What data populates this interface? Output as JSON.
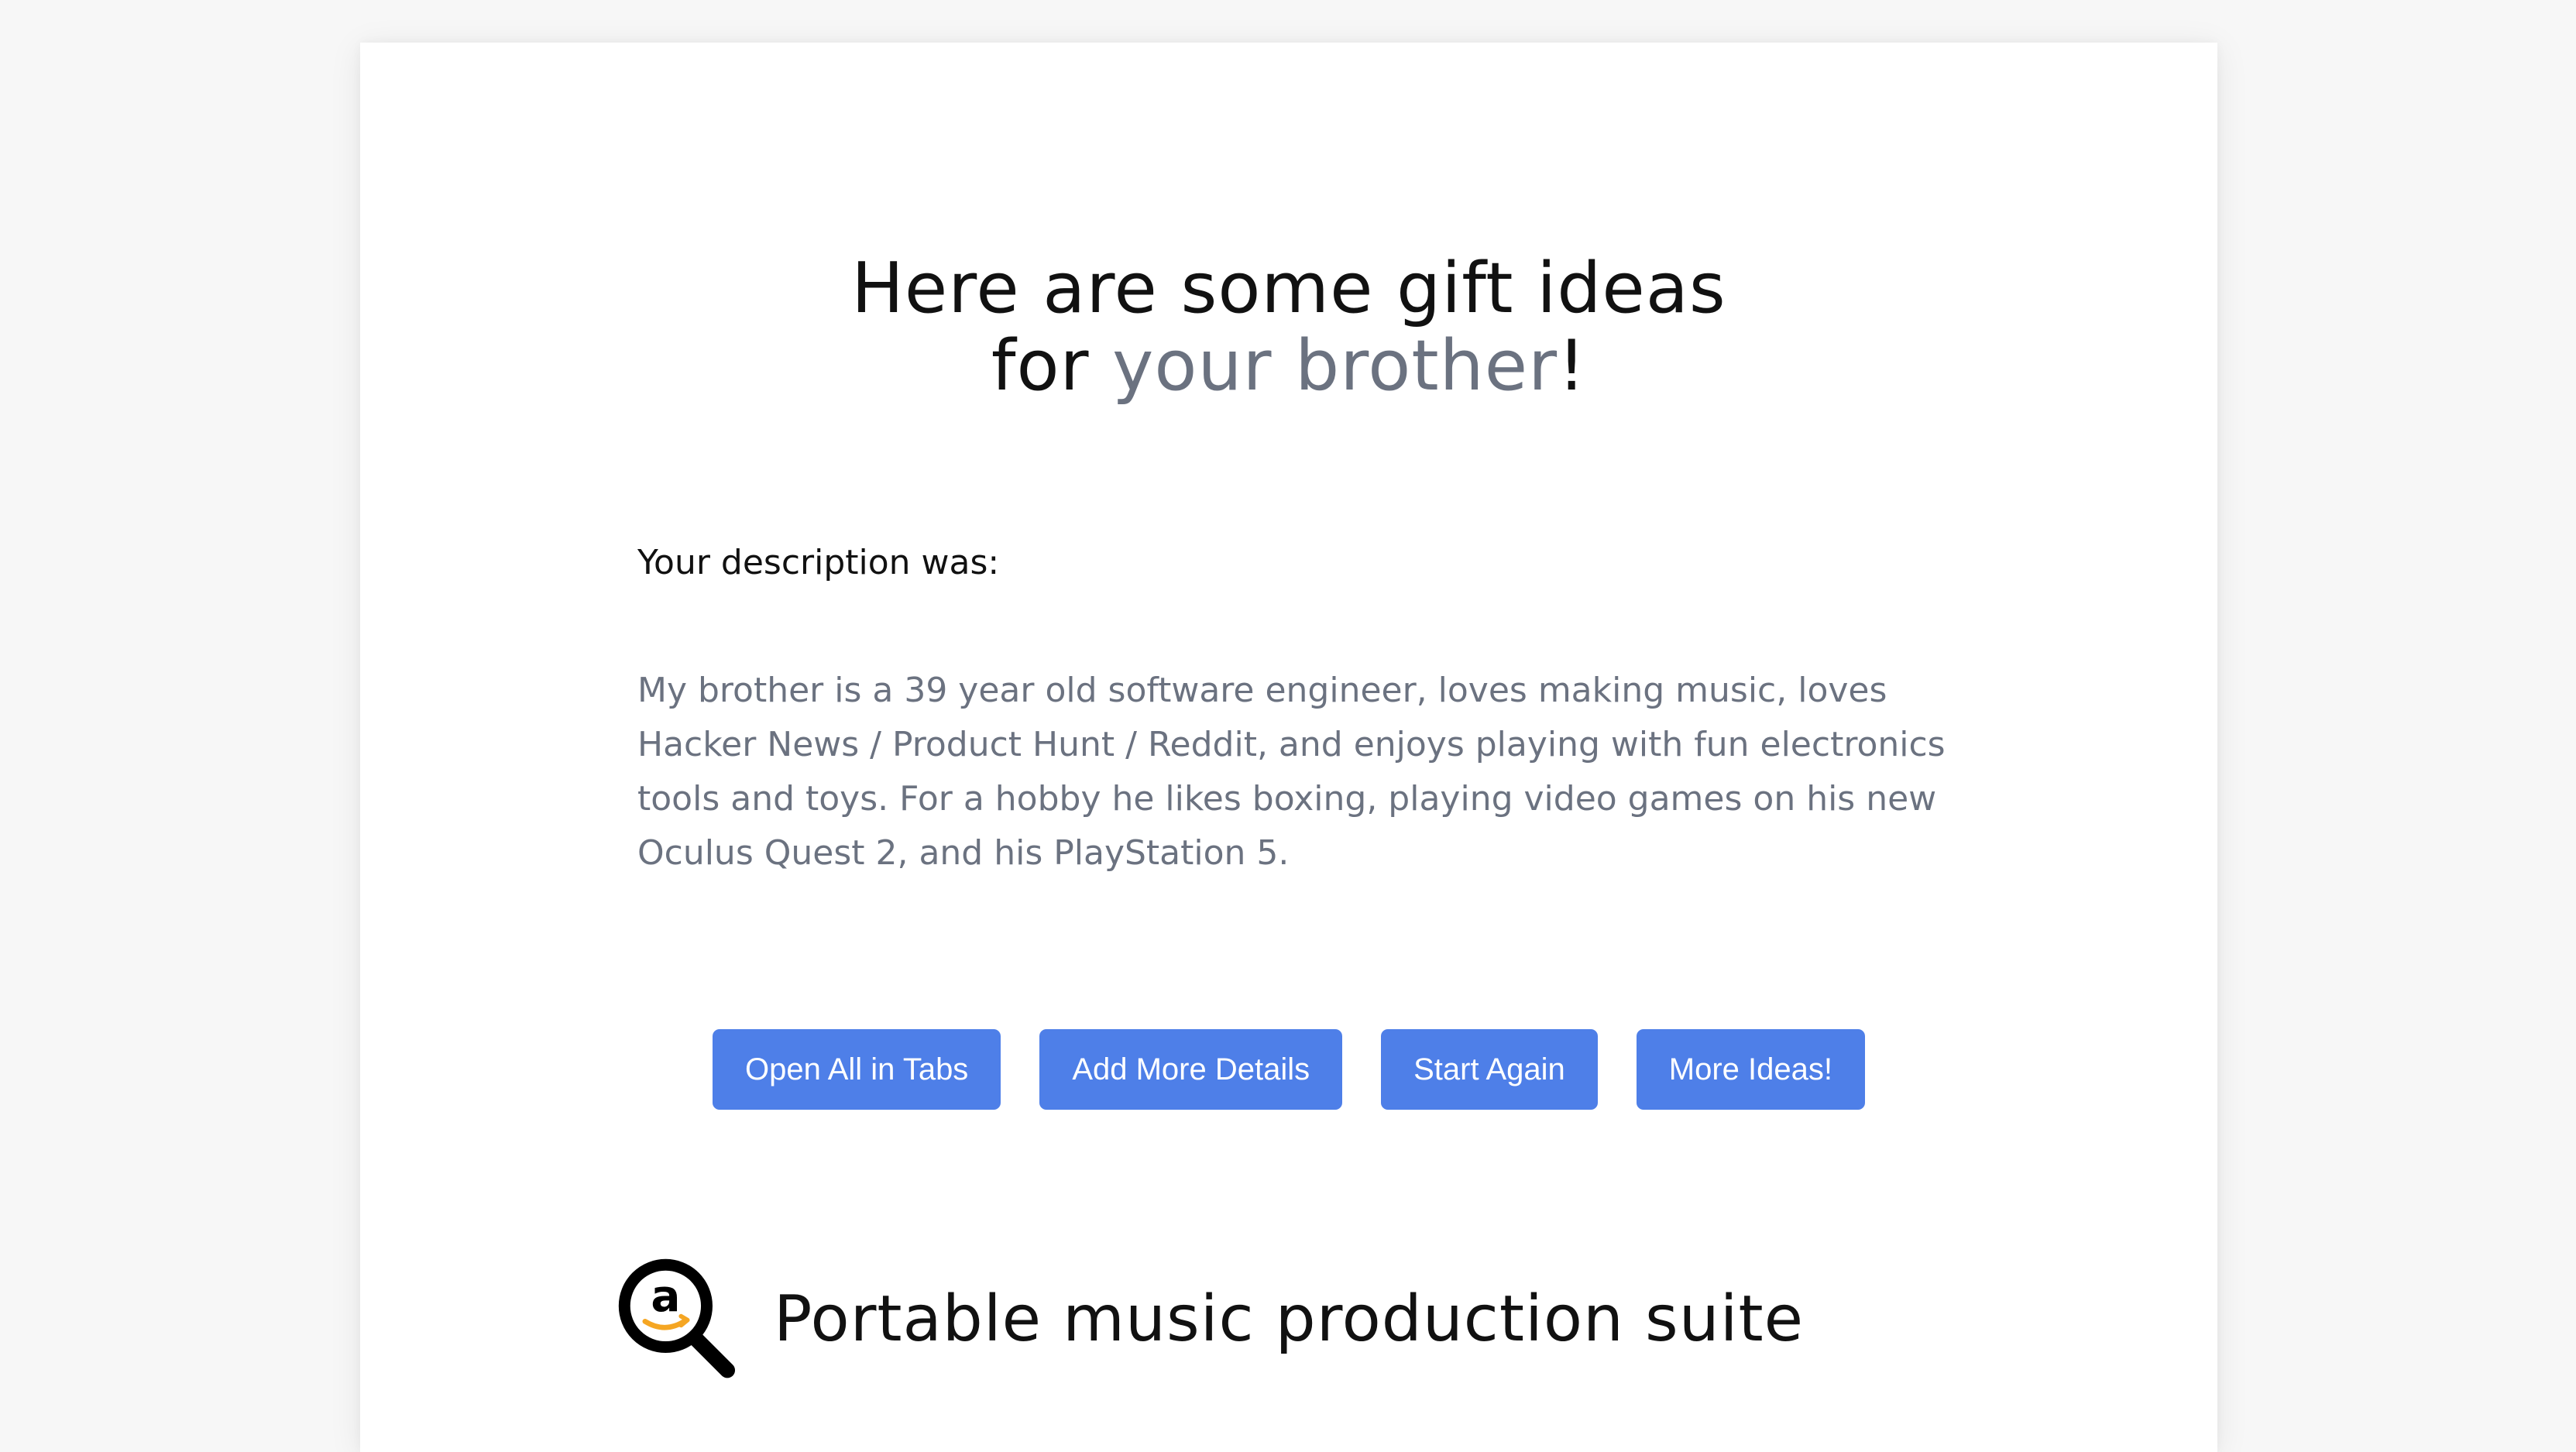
{
  "headline": {
    "line1": "Here are some gift ideas",
    "prefix": "for ",
    "recipient": "your brother",
    "suffix": "!"
  },
  "description": {
    "label": "Your description was:",
    "text": "My brother is a 39 year old software engineer, loves making music, loves Hacker News / Product Hunt / Reddit, and enjoys playing with fun electronics tools and toys. For a hobby he likes boxing, playing video games on his new Oculus Quest 2, and his PlayStation 5."
  },
  "buttons": {
    "open_all": "Open All in Tabs",
    "add_details": "Add More Details",
    "start_again": "Start Again",
    "more_ideas": "More Ideas!"
  },
  "ideas": [
    {
      "icon": "amazon-search-icon",
      "title": "Portable music production suite"
    }
  ],
  "colors": {
    "page_background": "#f7f7f7",
    "card_background": "#ffffff",
    "heading_text": "#111111",
    "accent_gray": "#6b7280",
    "button_blue": "#4e7fe8",
    "amazon_orange": "#f5a623"
  }
}
